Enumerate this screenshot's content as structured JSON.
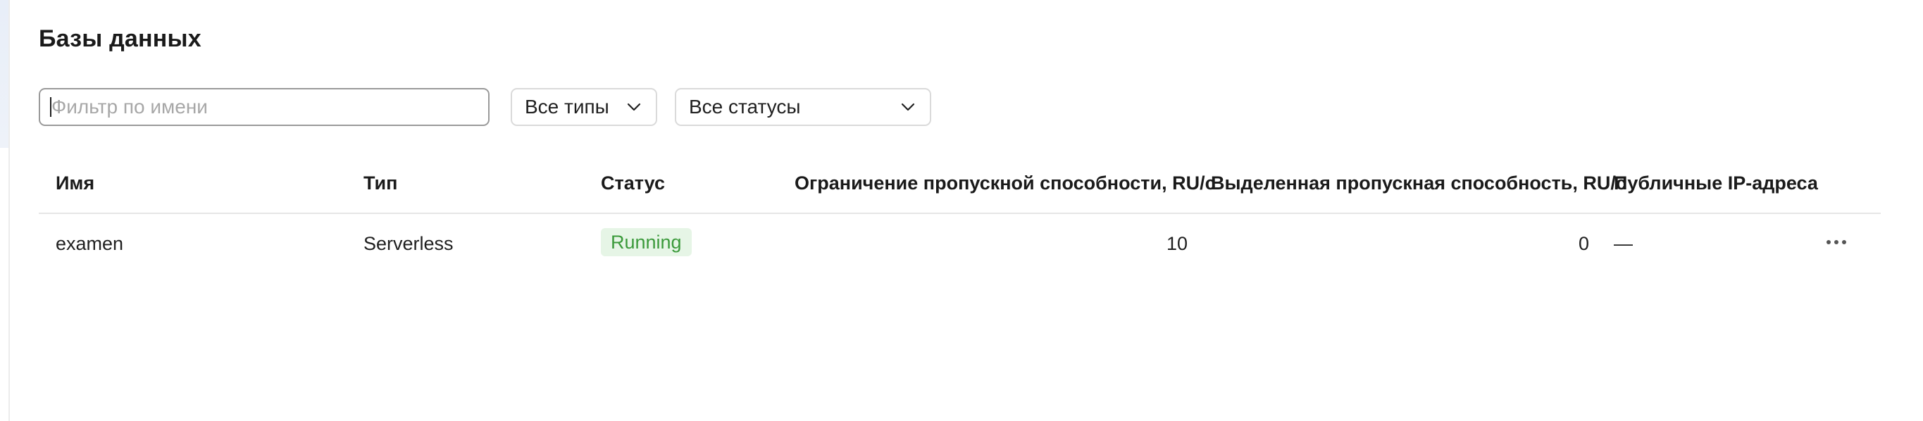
{
  "page": {
    "title": "Базы данных"
  },
  "filters": {
    "name_placeholder": "Фильтр по имени",
    "name_value": "",
    "type_selected": "Все типы",
    "status_selected": "Все статусы"
  },
  "table": {
    "columns": {
      "name": "Имя",
      "type": "Тип",
      "status": "Статус",
      "throughput_limit": "Ограничение пропускной способности, RU/с",
      "allocated_throughput": "Выделенная пропускная способность, RU/с",
      "public_ips": "Публичные IP-адреса"
    },
    "rows": [
      {
        "name": "examen",
        "type": "Serverless",
        "status": "Running",
        "throughput_limit": "10",
        "allocated_throughput": "0",
        "public_ips": "—"
      }
    ]
  },
  "colors": {
    "status_running_bg": "#e6f5e6",
    "status_running_text": "#3b9a3b",
    "input_border": "#9a9a9a",
    "select_border": "#dadada"
  },
  "icons": {
    "select_chevron": "chevron-down-icon",
    "row_actions": "more-horizontal-icon"
  }
}
